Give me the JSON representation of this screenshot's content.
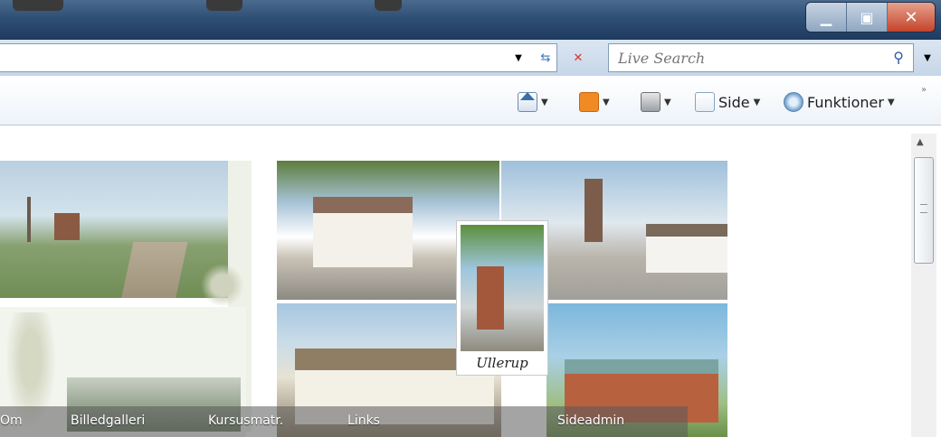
{
  "browser": {
    "search": {
      "placeholder": "Live Search"
    }
  },
  "commandbar": {
    "page_label": "Side",
    "tools_label": "Funktioner"
  },
  "content": {
    "postcard_signature": "Ullerup",
    "nav": {
      "items": [
        "Om",
        "Billedgalleri",
        "Kursusmatr.",
        "Links",
        "Sideadmin"
      ]
    }
  }
}
